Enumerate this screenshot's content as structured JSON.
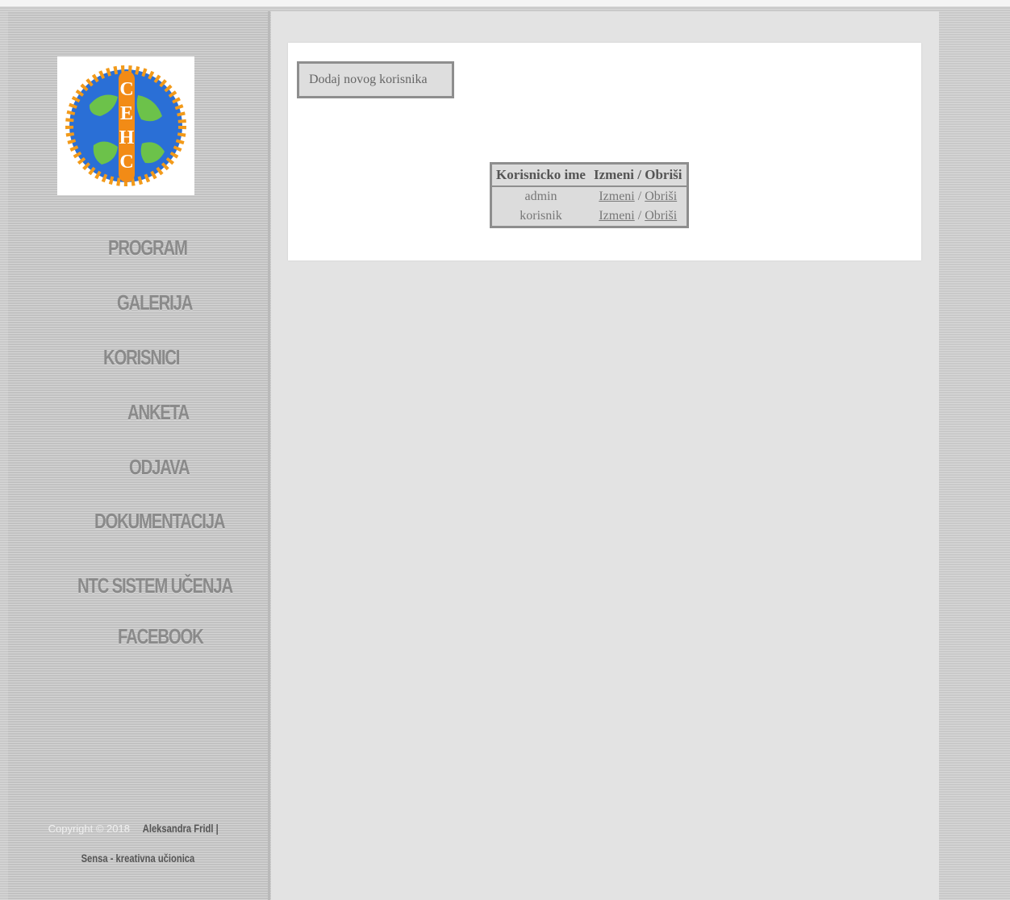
{
  "sidebar": {
    "nav": [
      {
        "label": "PROGRAM"
      },
      {
        "label": "GALERIJA"
      },
      {
        "label": "KORISNICI"
      },
      {
        "label": "ANKETA"
      },
      {
        "label": "ODJAVA"
      },
      {
        "label": "DOKUMENTACIJA"
      },
      {
        "label": "NTC SISTEM UČENJA"
      },
      {
        "label": "FACEBOOK"
      }
    ],
    "footer": {
      "copyright": "Copyright © 2018",
      "author": "Aleksandra Fridl |",
      "site": "Sensa - kreativna učionica"
    }
  },
  "main": {
    "add_button": "Dodaj novog korisnika",
    "table": {
      "headers": [
        "Korisnicko ime",
        "Izmeni / Obriši"
      ],
      "rows": [
        {
          "username": "admin",
          "edit": "Izmeni",
          "sep": "/",
          "delete": "Obriši"
        },
        {
          "username": "korisnik",
          "edit": "Izmeni",
          "sep": "/",
          "delete": "Obriši"
        }
      ]
    }
  },
  "colors": {
    "sidebar": "#c9c9c9",
    "main": "#e3e3e3",
    "nav_text": "#8a8a8a",
    "border": "#8e8e8e"
  }
}
